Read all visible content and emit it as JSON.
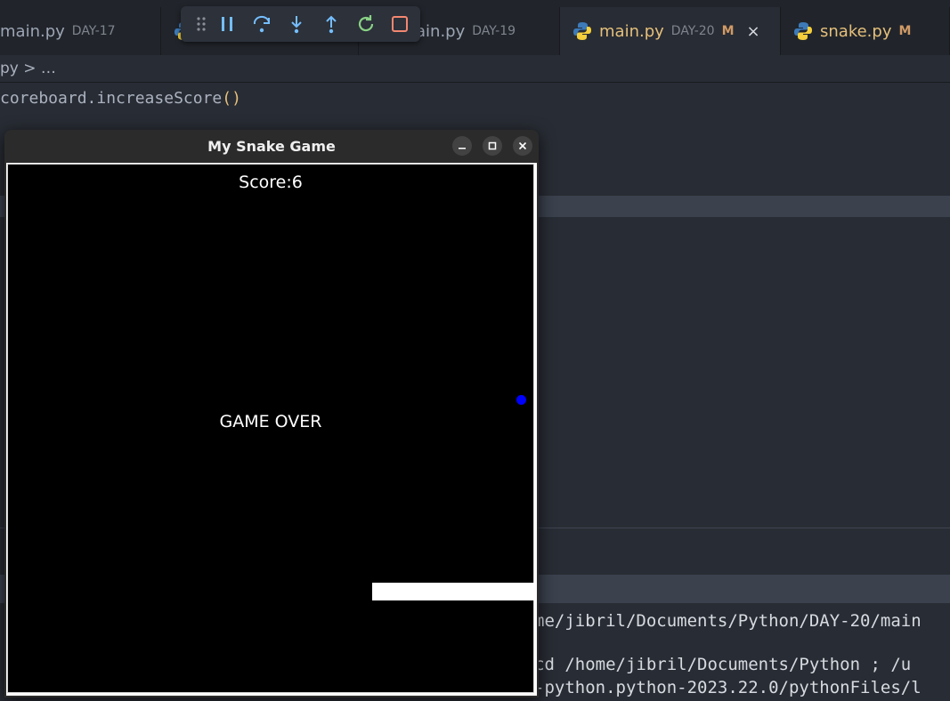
{
  "tabs": [
    {
      "name": "main.py",
      "dir": "DAY-17"
    },
    {
      "name": "main.py",
      "dir": "DAY-19",
      "visible_name": "ain.py"
    },
    {
      "name": "main.py",
      "dir": "DAY-20",
      "modified": "M",
      "close": "×"
    },
    {
      "name": "snake.py",
      "modified": "M"
    }
  ],
  "breadcrumb": "py > …",
  "editor": {
    "line1": "coreboard.increaseScore",
    "line1_parens": "()"
  },
  "terminal": {
    "line1": "me/jibril/Documents/Python/DAY-20/main",
    "line2": "cd /home/jibril/Documents/Python ; /u",
    "line3": "-python.python-2023.22.0/pythonFiles/l"
  },
  "debug_toolbar": {
    "buttons": [
      "grip-icon",
      "pause-icon",
      "step-over-icon",
      "step-into-icon",
      "step-out-icon",
      "restart-icon",
      "stop-icon"
    ]
  },
  "game_window": {
    "title": "My Snake Game",
    "minimize": "–",
    "maximize": "□",
    "close": "✕",
    "score_text": "Score:6",
    "game_over_text": "GAME OVER"
  },
  "colors": {
    "editor_bg": "#282c34",
    "game_bg": "#000000",
    "food": "#0000ff",
    "snake": "#ffffff",
    "modified": "#d19a66"
  }
}
